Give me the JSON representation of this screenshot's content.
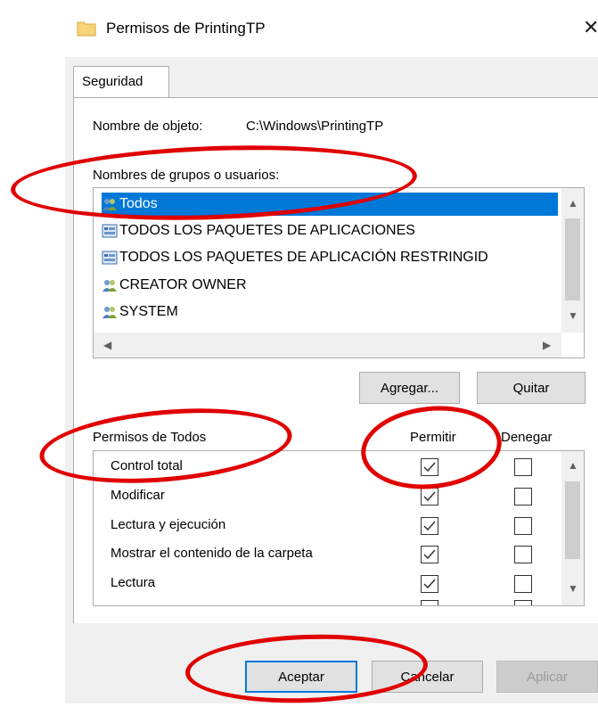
{
  "window": {
    "title": "Permisos de PrintingTP",
    "close_glyph": "✕"
  },
  "tab": {
    "label": "Seguridad"
  },
  "object": {
    "label": "Nombre de objeto:",
    "value": "C:\\Windows\\PrintingTP"
  },
  "groups": {
    "label": "Nombres de grupos o usuarios:",
    "items": [
      {
        "name": "Todos",
        "icon": "users-icon",
        "selected": true
      },
      {
        "name": "TODOS LOS PAQUETES DE APLICACIONES",
        "icon": "app-package-icon"
      },
      {
        "name": "TODOS LOS PAQUETES DE APLICACIÓN RESTRINGID",
        "icon": "app-package-icon"
      },
      {
        "name": "CREATOR OWNER",
        "icon": "users-icon"
      },
      {
        "name": "SYSTEM",
        "icon": "users-icon"
      }
    ]
  },
  "buttons": {
    "add": "Agregar...",
    "remove": "Quitar",
    "ok": "Aceptar",
    "cancel": "Cancelar",
    "apply": "Aplicar"
  },
  "permissions": {
    "label": "Permisos de Todos",
    "allow_header": "Permitir",
    "deny_header": "Denegar",
    "rows": [
      {
        "name": "Control total",
        "allow": true,
        "deny": false
      },
      {
        "name": "Modificar",
        "allow": true,
        "deny": false
      },
      {
        "name": "Lectura y ejecución",
        "allow": true,
        "deny": false
      },
      {
        "name": "Mostrar el contenido de la carpeta",
        "allow": true,
        "deny": false
      },
      {
        "name": "Lectura",
        "allow": true,
        "deny": false
      }
    ]
  },
  "colors": {
    "accent": "#0078d7",
    "annotation": "#e00000"
  }
}
